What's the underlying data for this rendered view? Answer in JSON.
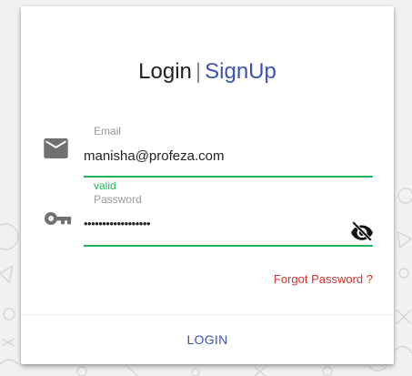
{
  "header": {
    "login_label": "Login",
    "separator": "|",
    "signup_label": "SignUp"
  },
  "email": {
    "label": "Email",
    "value": "manisha@profeza.com",
    "hint": "valid",
    "icon": "email-icon"
  },
  "password": {
    "label": "Password",
    "masked_value": "••••••••••••••••••",
    "icon": "key-icon",
    "toggle_icon": "visibility-off-icon"
  },
  "links": {
    "forgot_password": "Forgot Password ?"
  },
  "actions": {
    "login_label": "LOGIN"
  },
  "colors": {
    "accent": "#3f51b5",
    "valid": "#1fb55c",
    "danger": "#d32f2f"
  }
}
